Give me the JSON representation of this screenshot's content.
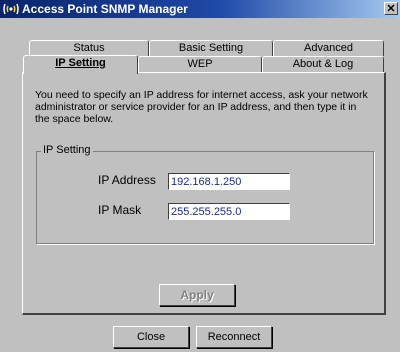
{
  "window": {
    "title": "Access Point SNMP Manager",
    "close_glyph": "✕"
  },
  "tabs": {
    "row1": [
      "Status",
      "Basic Setting",
      "Advanced"
    ],
    "row2": [
      "IP Setting",
      "WEP",
      "About & Log"
    ],
    "active": "IP Setting"
  },
  "ip_setting": {
    "instructions": "You need to specify an IP address for internet access, ask your network administrator or service provider for an IP address, and then type it in the space below.",
    "group_label": "IP Setting",
    "ip_address_label": "IP Address",
    "ip_address_value": "192.168.1.250",
    "ip_mask_label": "IP Mask",
    "ip_mask_value": "255.255.255.0",
    "apply_label": "Apply"
  },
  "footer": {
    "close_label": "Close",
    "reconnect_label": "Reconnect"
  },
  "icons": {
    "app": "network-wave-icon"
  }
}
